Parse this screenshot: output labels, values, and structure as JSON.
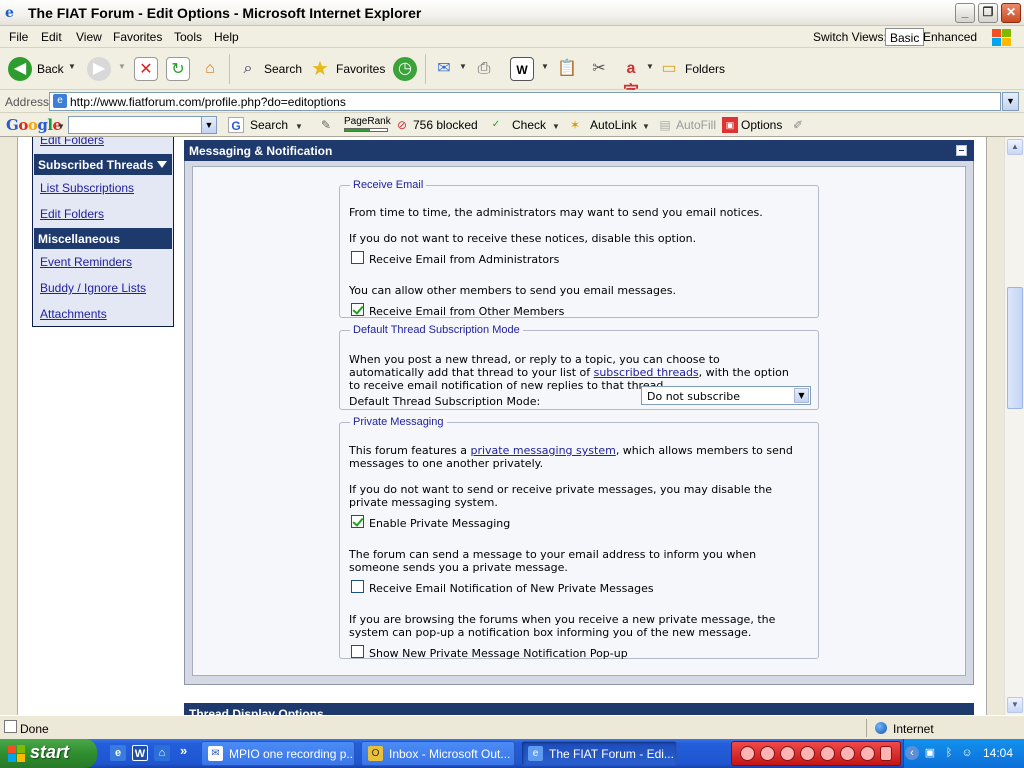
{
  "window": {
    "title": "The FIAT Forum - Edit Options - Microsoft Internet Explorer",
    "minimize": "_",
    "maximize": "❐",
    "close": "✕"
  },
  "menu": {
    "items": [
      "File",
      "Edit",
      "View",
      "Favorites",
      "Tools",
      "Help"
    ],
    "switch_views_label": "Switch Views:",
    "view_basic": "Basic",
    "view_enhanced": "Enhanced"
  },
  "toolbar": {
    "back": "Back",
    "search": "Search",
    "favorites": "Favorites",
    "folders": "Folders"
  },
  "address": {
    "label": "Address",
    "url": "http://www.fiatforum.com/profile.php?do=editoptions"
  },
  "google_toolbar": {
    "logo": "Google",
    "search": "Search",
    "pagerank": "PageRank",
    "blocked": "756 blocked",
    "check": "Check",
    "autolink": "AutoLink",
    "autofill": "AutoFill",
    "options": "Options"
  },
  "sidebar": {
    "edit_folders_top": "Edit Folders",
    "subscribed_threads": "Subscribed Threads",
    "list_subscriptions": "List Subscriptions",
    "edit_folders": "Edit Folders",
    "miscellaneous": "Miscellaneous",
    "event_reminders": "Event Reminders",
    "buddy_ignore": "Buddy / Ignore Lists",
    "attachments": "Attachments"
  },
  "panel": {
    "title": "Messaging & Notification",
    "next_title": "Thread Display Options"
  },
  "receive_email": {
    "legend": "Receive Email",
    "text1": "From time to time, the administrators may want to send you email notices.",
    "text2": "If you do not want to receive these notices, disable this option.",
    "admin_label": "Receive Email from Administrators",
    "admin_checked": false,
    "text3": "You can allow other members to send you email messages.",
    "members_label": "Receive Email from Other Members",
    "members_checked": true
  },
  "subscription": {
    "legend": "Default Thread Subscription Mode",
    "line1": "When you post a new thread, or reply to a topic, you can choose to",
    "line2_pre": "automatically add that thread to your list of ",
    "line2_link": "subscribed threads",
    "line2_post": ", with the option",
    "line3": "to receive email notification of new replies to that thread.",
    "mode_label": "Default Thread Subscription Mode:",
    "mode_value": "Do not subscribe"
  },
  "private_messaging": {
    "legend": "Private Messaging",
    "line1_pre": "This forum features a ",
    "line1_link": "private messaging system",
    "line1_post": ", which allows members to send",
    "line2": "messages to one another privately.",
    "line3": "If you do not want to send or receive private messages, you may disable the",
    "line4": "private messaging system.",
    "enable_label": "Enable Private Messaging",
    "enable_checked": true,
    "line5": "The forum can send a message to your email address to inform you when",
    "line6": "someone sends you a private message.",
    "notify_label": "Receive Email Notification of New Private Messages",
    "notify_checked": false,
    "line7": "If you are browsing the forums when you receive a new private message, the",
    "line8": "system can pop-up a notification box informing you of the new message.",
    "popup_label": "Show New Private Message Notification Pop-up",
    "popup_checked": false
  },
  "status": {
    "text": "Done",
    "zone": "Internet"
  },
  "taskbar": {
    "start": "start",
    "tasks": [
      "MPIO one recording p...",
      "Inbox - Microsoft Out...",
      "The FIAT Forum - Edi..."
    ],
    "clock": "14:04"
  }
}
